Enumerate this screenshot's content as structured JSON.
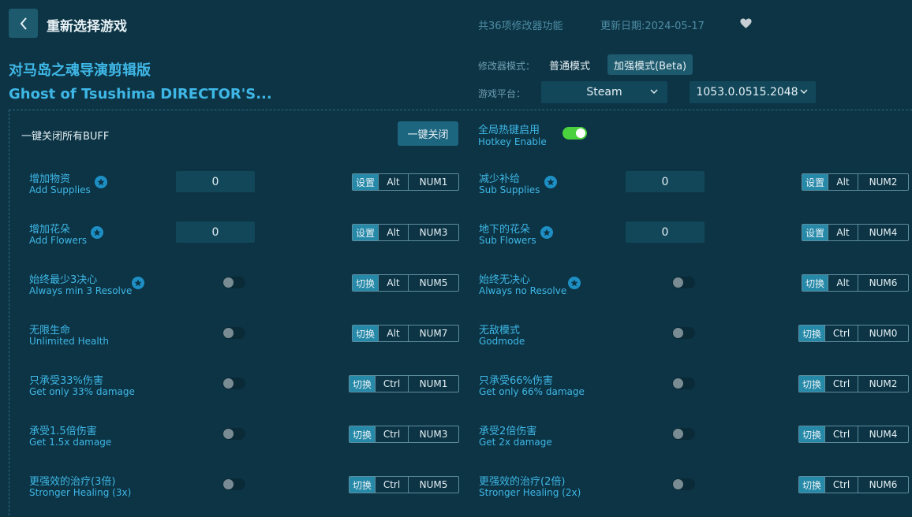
{
  "header": {
    "title": "重新选择游戏",
    "features_count": "共36项修改器功能",
    "update_date": "更新日期:2024-05-17"
  },
  "game": {
    "name_cn": "对马岛之魂导演剪辑版",
    "name_en": "Ghost of Tsushima DIRECTOR'S..."
  },
  "mode": {
    "label": "修改器模式：",
    "normal": "普通模式",
    "enhanced": "加强模式(Beta)"
  },
  "platform": {
    "label": "游戏平台：",
    "selected": "Steam",
    "version": "1053.0.0515.2048"
  },
  "controls": {
    "close_all_label": "一键关闭所有BUFF",
    "close_all_button": "一键关闭",
    "hotkey_cn": "全局热键启用",
    "hotkey_en": "Hotkey Enable"
  },
  "features": [
    {
      "cn": "增加物资",
      "en": "Add Supplies",
      "star": true,
      "type": "input",
      "value": "0",
      "action": "设置",
      "mod": "Alt",
      "key": "NUM1"
    },
    {
      "cn": "减少补给",
      "en": "Sub Supplies",
      "star": true,
      "type": "input",
      "value": "0",
      "action": "设置",
      "mod": "Alt",
      "key": "NUM2"
    },
    {
      "cn": "增加花朵",
      "en": "Add Flowers",
      "star": true,
      "type": "input",
      "value": "0",
      "action": "设置",
      "mod": "Alt",
      "key": "NUM3"
    },
    {
      "cn": "地下的花朵",
      "en": "Sub Flowers",
      "star": true,
      "type": "input",
      "value": "0",
      "action": "设置",
      "mod": "Alt",
      "key": "NUM4"
    },
    {
      "cn": "始终最少3决心",
      "en": "Always min 3 Resolve",
      "star": true,
      "type": "toggle",
      "action": "切换",
      "mod": "Alt",
      "key": "NUM5"
    },
    {
      "cn": "始终无决心",
      "en": "Always no Resolve",
      "star": true,
      "type": "toggle",
      "action": "切换",
      "mod": "Alt",
      "key": "NUM6"
    },
    {
      "cn": "无限生命",
      "en": "Unlimited Health",
      "star": false,
      "type": "toggle",
      "action": "切换",
      "mod": "Alt",
      "key": "NUM7"
    },
    {
      "cn": "无敌模式",
      "en": "Godmode",
      "star": false,
      "type": "toggle",
      "action": "切换",
      "mod": "Ctrl",
      "key": "NUM0"
    },
    {
      "cn": "只承受33%伤害",
      "en": "Get only 33% damage",
      "star": false,
      "type": "toggle",
      "action": "切换",
      "mod": "Ctrl",
      "key": "NUM1"
    },
    {
      "cn": "只承受66%伤害",
      "en": "Get only 66% damage",
      "star": false,
      "type": "toggle",
      "action": "切换",
      "mod": "Ctrl",
      "key": "NUM2"
    },
    {
      "cn": "承受1.5倍伤害",
      "en": "Get 1.5x damage",
      "star": false,
      "type": "toggle",
      "action": "切换",
      "mod": "Ctrl",
      "key": "NUM3"
    },
    {
      "cn": "承受2倍伤害",
      "en": "Get 2x damage",
      "star": false,
      "type": "toggle",
      "action": "切换",
      "mod": "Ctrl",
      "key": "NUM4"
    },
    {
      "cn": "更强效的治疗(3倍)",
      "en": "Stronger Healing (3x)",
      "star": false,
      "type": "toggle",
      "action": "切换",
      "mod": "Ctrl",
      "key": "NUM5"
    },
    {
      "cn": "更强效的治疗(2倍)",
      "en": "Stronger Healing (2x)",
      "star": false,
      "type": "toggle",
      "action": "切换",
      "mod": "Ctrl",
      "key": "NUM6"
    }
  ]
}
